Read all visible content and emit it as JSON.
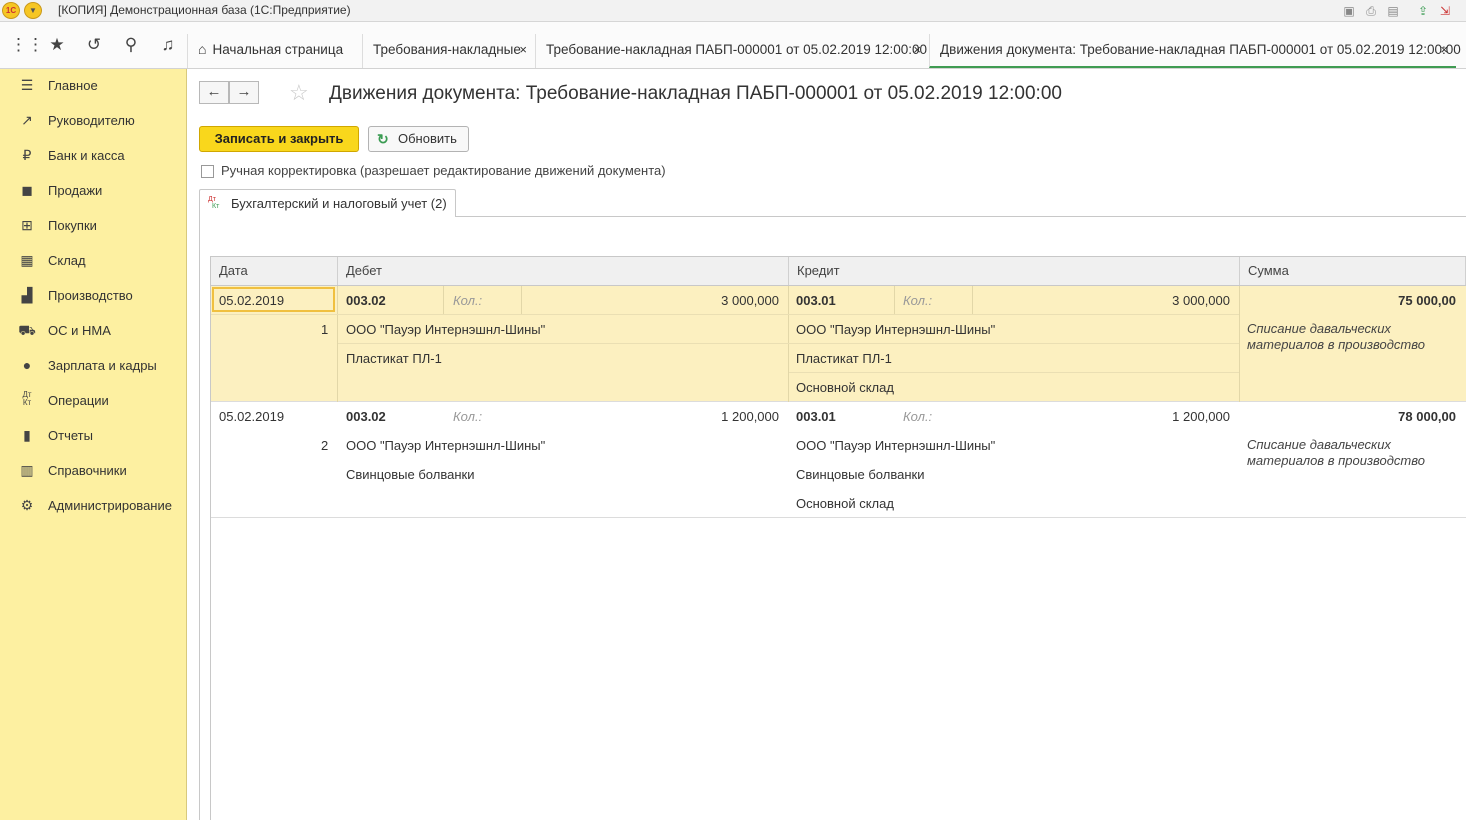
{
  "window": {
    "logo": "1С",
    "title": "[КОПИЯ] Демонстрационная база  (1С:Предприятие)"
  },
  "tabs": [
    {
      "label": "Начальная страница"
    },
    {
      "label": "Требования-накладные"
    },
    {
      "label": "Требование-накладная ПАБП-000001 от 05.02.2019 12:00:00"
    },
    {
      "label": "Движения документа: Требование-накладная ПАБП-000001 от 05.02.2019 12:00:00"
    }
  ],
  "tab_close": "×",
  "sidebar": {
    "items": [
      {
        "label": "Главное",
        "icon": "menu-icon"
      },
      {
        "label": "Руководителю",
        "icon": "trend-icon"
      },
      {
        "label": "Банк и касса",
        "icon": "ruble-icon"
      },
      {
        "label": "Продажи",
        "icon": "bag-icon"
      },
      {
        "label": "Покупки",
        "icon": "cart-icon"
      },
      {
        "label": "Склад",
        "icon": "warehouse-icon"
      },
      {
        "label": "Производство",
        "icon": "factory-icon"
      },
      {
        "label": "ОС и НМА",
        "icon": "truck-icon"
      },
      {
        "label": "Зарплата и кадры",
        "icon": "person-icon"
      },
      {
        "label": "Операции",
        "icon": "dt-kt-icon"
      },
      {
        "label": "Отчеты",
        "icon": "bar-chart-icon"
      },
      {
        "label": "Справочники",
        "icon": "book-icon"
      },
      {
        "label": "Администрирование",
        "icon": "gear-icon"
      }
    ]
  },
  "doc": {
    "title": "Движения документа: Требование-накладная ПАБП-000001 от 05.02.2019 12:00:00",
    "save_close": "Записать и закрыть",
    "refresh": "Обновить",
    "manual_edit": "Ручная корректировка (разрешает редактирование движений документа)",
    "subtab": "Бухгалтерский и налоговый учет (2)",
    "dt": "Дт",
    "kt": "Кт"
  },
  "table": {
    "headers": {
      "date": "Дата",
      "debit": "Дебет",
      "credit": "Кредит",
      "sum": "Сумма"
    },
    "kol_label": "Кол.:",
    "rows": [
      {
        "date": "05.02.2019",
        "num": "1",
        "debit_account": "003.02",
        "debit_qty": "3 000,000",
        "debit_sub1": "ООО \"Пауэр Интернэшнл-Шины\"",
        "debit_sub2": "Пластикат ПЛ-1",
        "credit_account": "003.01",
        "credit_qty": "3 000,000",
        "credit_sub1": "ООО \"Пауэр Интернэшнл-Шины\"",
        "credit_sub2": "Пластикат ПЛ-1",
        "credit_sub3": "Основной склад",
        "sum": "75 000,00",
        "content": "Списание давальческих материалов в производство"
      },
      {
        "date": "05.02.2019",
        "num": "2",
        "debit_account": "003.02",
        "debit_qty": "1 200,000",
        "debit_sub1": "ООО \"Пауэр Интернэшнл-Шины\"",
        "debit_sub2": "Свинцовые болванки",
        "credit_account": "003.01",
        "credit_qty": "1 200,000",
        "credit_sub1": "ООО \"Пауэр Интернэшнл-Шины\"",
        "credit_sub2": "Свинцовые болванки",
        "credit_sub3": "Основной склад",
        "sum": "78 000,00",
        "content": "Списание давальческих материалов в производство"
      }
    ]
  }
}
